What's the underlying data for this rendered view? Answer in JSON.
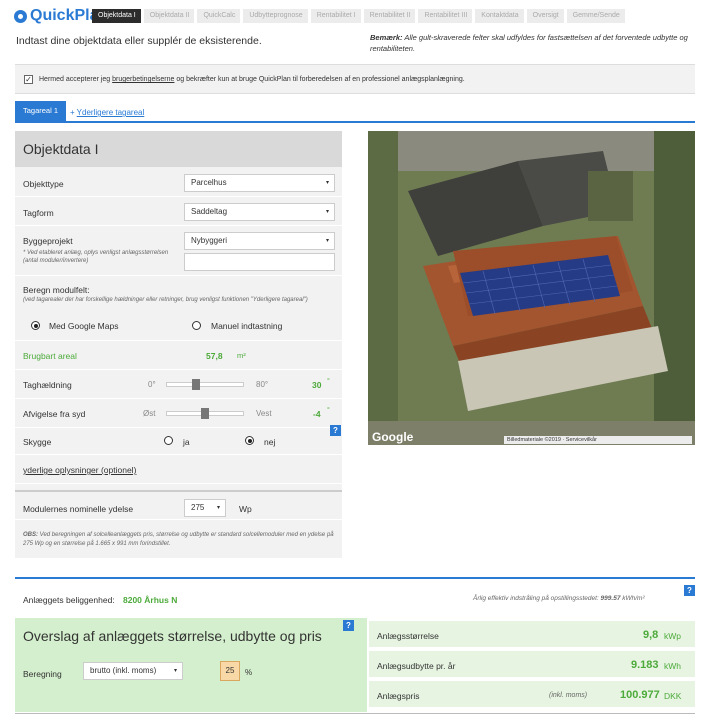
{
  "header": {
    "logo": "QuickPlan",
    "steps": [
      "Objektdata I",
      "Objektdata II",
      "QuickCalc",
      "Udbytteprognose",
      "Rentabilitet I",
      "Rentabilitet II",
      "Rentabilitet III",
      "Kontaktdata",
      "Oversigt",
      "Gemme/Sende"
    ]
  },
  "intro": "Indtast dine objektdata eller supplér de eksisterende.",
  "note": {
    "bold": "Bemærk:",
    "text": " Alle gult-skraverede felter skal udfyldes for fastsættelsen af det forventede udbytte og rentabiliteten."
  },
  "agree": {
    "checkmark": "✓",
    "pre": "Hermed accepterer jeg ",
    "link": "brugerbetingelserne",
    "post": " og bekræfter kun at bruge QuickPlan til forberedelsen af en professionel anlægsplanlægning."
  },
  "tabs": {
    "active": "Tagareal 1",
    "add": "Yderligere tagareal",
    "plus": "+"
  },
  "form": {
    "title": "Objektdata I",
    "objekttype": {
      "label": "Objekttype",
      "value": "Parcelhus"
    },
    "tagform": {
      "label": "Tagform",
      "value": "Saddeltag"
    },
    "byggeprojekt": {
      "label": "Byggeprojekt",
      "value": "Nybyggeri",
      "hint": "* Ved etableret anlæg, oplys venligst anlægsstørrelsen (antal moduler/invertere)"
    },
    "modulfelt": {
      "label": "Beregn modulfelt:",
      "hint": "(ved tagarealer der har forskellige hældninger eller retninger, brug venligst funktionen \"Yderligere tagareal\")",
      "opt1": "Med Google Maps",
      "opt2": "Manuel indtastning"
    },
    "areal": {
      "label": "Brugbart areal",
      "value": "57,8",
      "unit": "m²"
    },
    "haeldning": {
      "label": "Taghældning",
      "min": "0°",
      "max": "80°",
      "value": "30",
      "unit": "°"
    },
    "afvigelse": {
      "label": "Afvigelse fra syd",
      "min": "Øst",
      "max": "Vest",
      "value": "-4",
      "unit": "°"
    },
    "skygge": {
      "label": "Skygge",
      "opt1": "ja",
      "opt2": "nej"
    },
    "more": "yderlige oplysninger (optionel)",
    "ydelse": {
      "label": "Modulernes nominelle ydelse",
      "value": "275",
      "unit": "Wp"
    },
    "obs": {
      "bold": "OBS:",
      "text": " Ved beregningen af solcelleanlæggets pris, størrelse og udbytte er standard solcellemoduler med en ydelse på 275 Wp og en størrelse på 1.665 x 991 mm forindstillet."
    }
  },
  "map": {
    "brand": "Google",
    "attribution": "Billedmateriale ©2019 · Servicevilkår"
  },
  "location": {
    "label": "Anlæggets beliggenhed:",
    "value": "8200 Århus N",
    "irr_label": "Årlig effektiv indstråling på opstillingsstedet:",
    "irr_value": "999.57",
    "irr_unit": "kWh/m²"
  },
  "summary": {
    "title": "Overslag af anlæggets størrelse, udbytte og pris",
    "beregning": {
      "label": "Beregning",
      "value": "brutto (inkl. moms)",
      "pct": "25",
      "pct_unit": "%"
    },
    "rows": [
      {
        "label": "Anlægsstørrelse",
        "value": "9,8",
        "unit": "kWp",
        "note": ""
      },
      {
        "label": "Anlægsudbytte pr. år",
        "value": "9.183",
        "unit": "kWh",
        "note": ""
      },
      {
        "label": "Anlægspris",
        "value": "100.977",
        "unit": "DKK",
        "note": "(inkl. moms)"
      }
    ]
  },
  "icons": {
    "help": "?",
    "caret": "▾"
  },
  "colors": {
    "accent": "#2a7ad4",
    "green": "#4caa3a",
    "summary_bg": "#d4efcd"
  }
}
